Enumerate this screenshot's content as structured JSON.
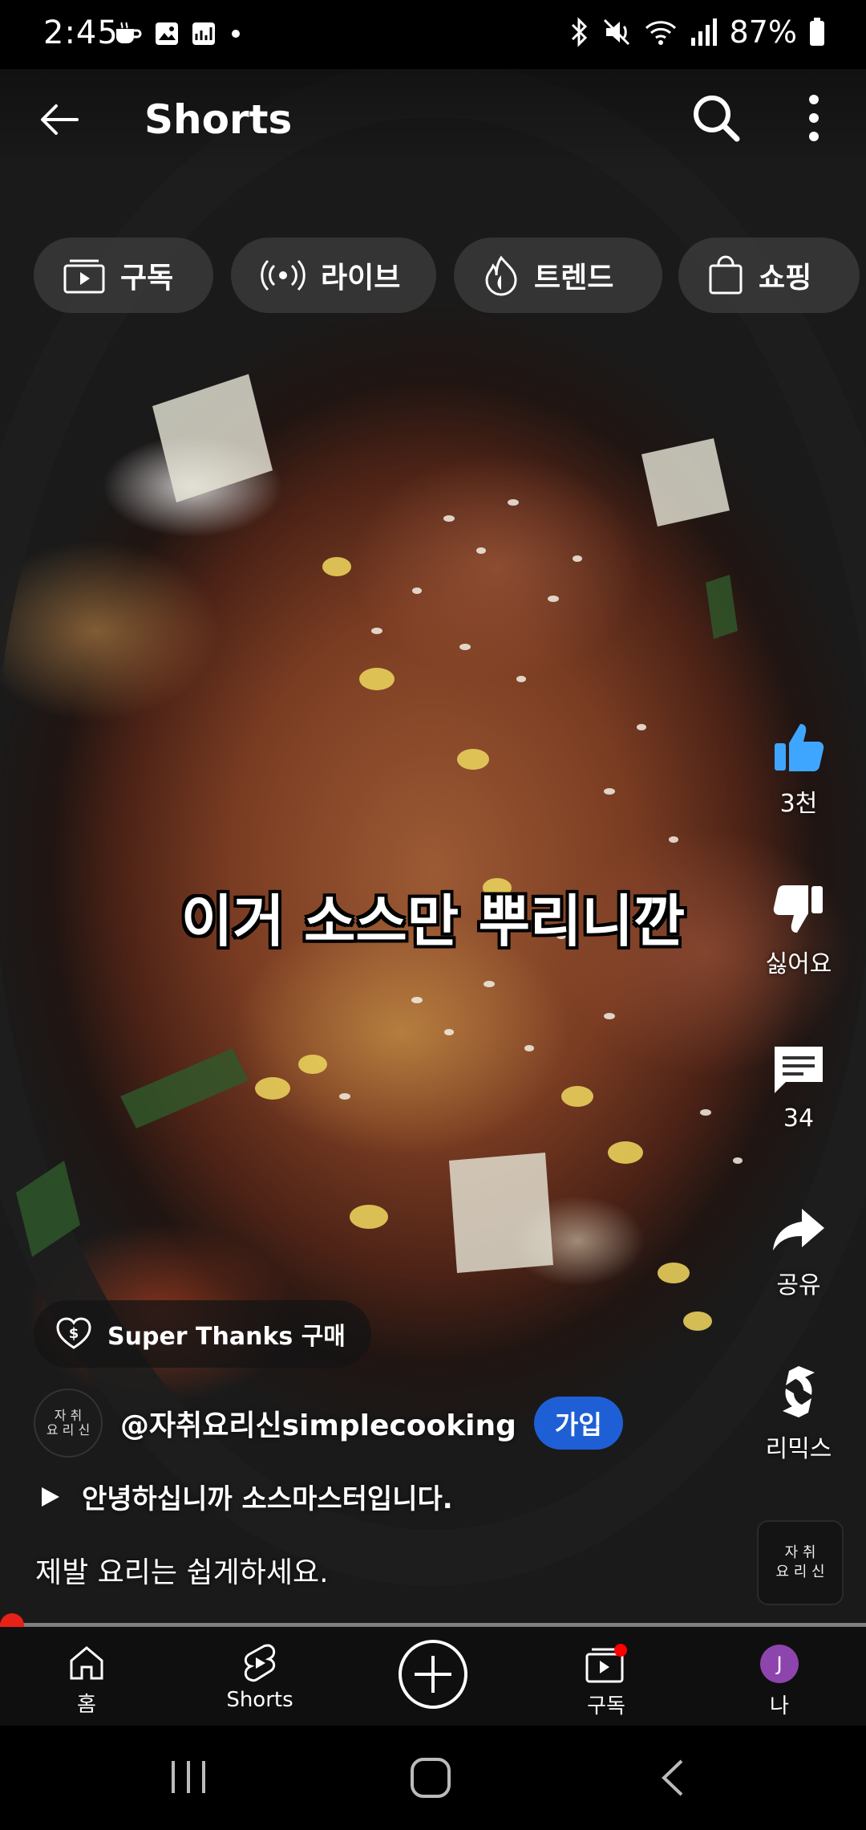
{
  "status_bar": {
    "time": "2:45",
    "left_icons": [
      "coffee-icon",
      "gallery-icon",
      "chart-icon",
      "dot-icon"
    ],
    "right_icons": [
      "bluetooth-icon",
      "vibrate-mute-icon",
      "wifi-icon",
      "signal-icon"
    ],
    "battery": "87%"
  },
  "app_bar": {
    "title": "Shorts"
  },
  "chips": [
    {
      "icon": "subscriptions-icon",
      "label": "구독"
    },
    {
      "icon": "live-icon",
      "label": "라이브"
    },
    {
      "icon": "trending-icon",
      "label": "트렌드"
    },
    {
      "icon": "shopping-bag-icon",
      "label": "쇼핑"
    }
  ],
  "caption": "이거 소스만 뿌리니깐",
  "actions": {
    "like": "3천",
    "dislike": "싫어요",
    "comments": "34",
    "share": "공유",
    "remix": "리믹스"
  },
  "super_thanks": "Super Thanks 구매",
  "channel": {
    "avatar_text": "자 취\n요 리 신",
    "handle": "@자취요리신simplecooking",
    "join_label": "가입"
  },
  "description": "안녕하십니까 소스마스터입니다.",
  "subtitle": "제발 요리는 쉽게하세요.",
  "music_thumb_text": "자 취\n요 리 신",
  "progress_fraction": 0.01,
  "bottom_nav": [
    {
      "icon": "home-icon",
      "label": "홈"
    },
    {
      "icon": "shorts-icon",
      "label": "Shorts"
    },
    {
      "icon": "create-icon",
      "label": ""
    },
    {
      "icon": "subscriptions-icon",
      "label": "구독"
    },
    {
      "icon": "avatar-icon",
      "label": "나",
      "avatar_letter": "J"
    }
  ],
  "colors": {
    "join_button": "#1f5fd6",
    "progress": "#e62117",
    "like_icon": "#3ea6ff",
    "avatar": "#8e44ad"
  }
}
